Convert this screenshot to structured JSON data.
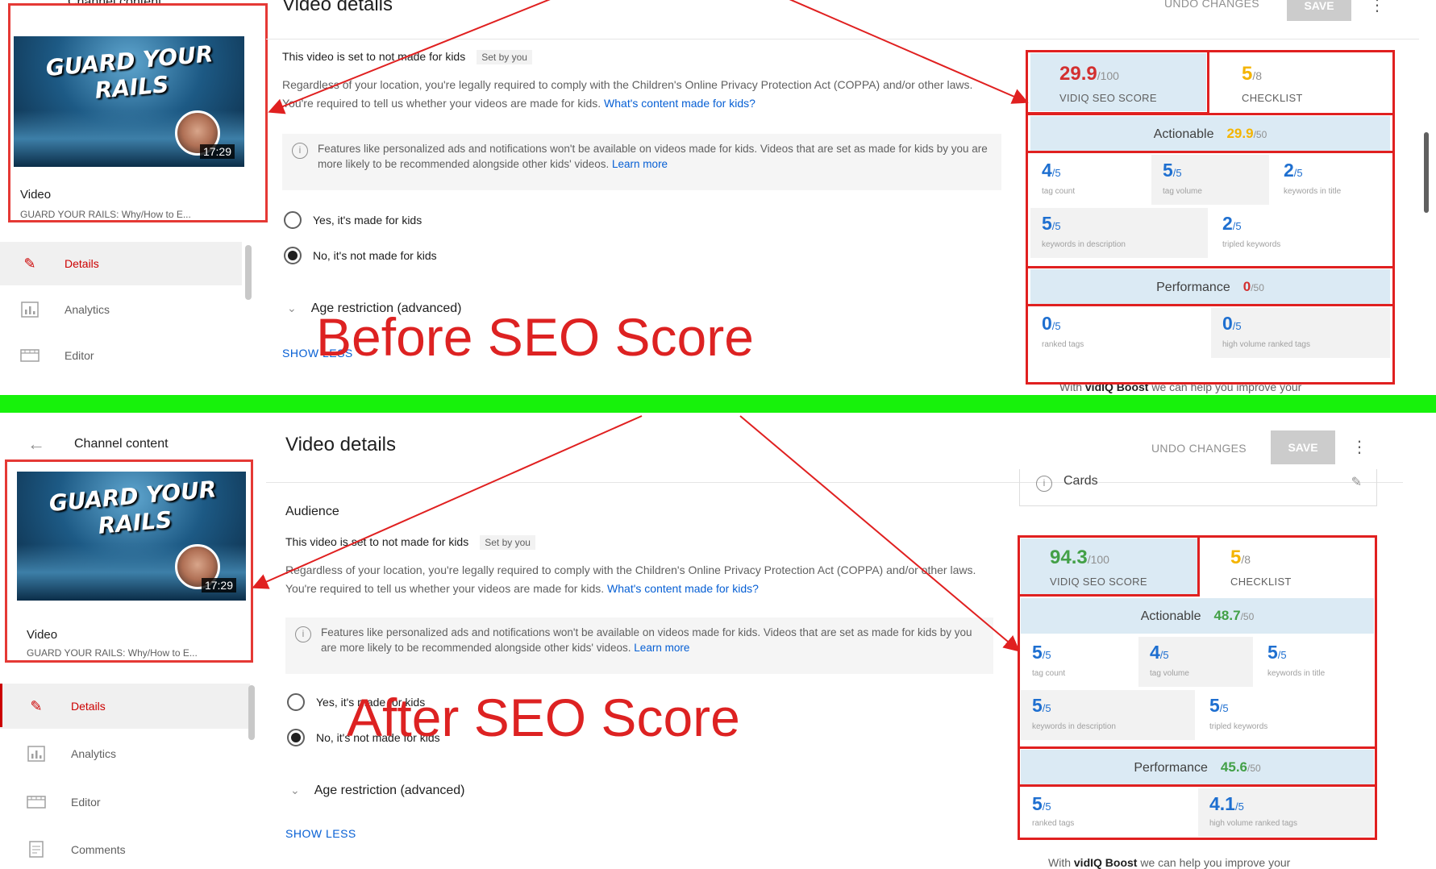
{
  "before": {
    "channel_content": "Channel content",
    "page_title": "Video details",
    "thumbnail_text": "GUARD YOUR RAILS",
    "duration": "17:29",
    "video_label": "Video",
    "video_subtitle": "GUARD YOUR RAILS: Why/How to E...",
    "nav": [
      {
        "label": "Details",
        "icon": "pencil-icon"
      },
      {
        "label": "Analytics",
        "icon": "bar-chart-icon"
      },
      {
        "label": "Editor",
        "icon": "film-icon"
      }
    ],
    "kids_line": "This video is set to not made for kids",
    "set_by_you": "Set by you",
    "body_text": "Regardless of your location, you're legally required to comply with the Children's Online Privacy Protection Act (COPPA) and/or other laws. You're required to tell us whether your videos are made for kids.",
    "body_link": "What's content made for kids?",
    "info_text": "Features like personalized ads and notifications won't be available on videos made for kids. Videos that are set as made for kids by you are more likely to be recommended alongside other kids' videos.",
    "info_link": "Learn more",
    "radio_yes": "Yes, it's made for kids",
    "radio_no": "No, it's not made for kids",
    "age_restriction": "Age restriction (advanced)",
    "show_link": "SHOW LESS",
    "undo": "UNDO CHANGES",
    "save": "SAVE",
    "overlay": "Before SEO Score",
    "seo": {
      "score": "29.9",
      "score_den": "/100",
      "score_label": "VIDIQ SEO SCORE",
      "checklist": "5",
      "checklist_den": "/8",
      "checklist_label": "CHECKLIST",
      "actionable_label": "Actionable",
      "actionable_score": "29.9",
      "actionable_den": "/50",
      "performance_label": "Performance",
      "performance_score": "0",
      "performance_den": "/50",
      "actionable_metrics": [
        {
          "value": "4",
          "den": "/5",
          "label": "tag count"
        },
        {
          "value": "5",
          "den": "/5",
          "label": "tag volume"
        },
        {
          "value": "2",
          "den": "/5",
          "label": "keywords in title"
        },
        {
          "value": "5",
          "den": "/5",
          "label": "keywords in description"
        },
        {
          "value": "2",
          "den": "/5",
          "label": "tripled keywords"
        }
      ],
      "performance_metrics": [
        {
          "value": "0",
          "den": "/5",
          "label": "ranked tags"
        },
        {
          "value": "0",
          "den": "/5",
          "label": "high volume ranked tags"
        }
      ],
      "boost_prefix": "With ",
      "boost_brand": "vidIQ Boost",
      "boost_suffix": " we can help you improve your"
    }
  },
  "after": {
    "channel_content": "Channel content",
    "page_title": "Video details",
    "audience": "Audience",
    "thumbnail_text": "GUARD YOUR RAILS",
    "duration": "17:29",
    "video_label": "Video",
    "video_subtitle": "GUARD YOUR RAILS: Why/How to E...",
    "nav": [
      {
        "label": "Details",
        "icon": "pencil-icon"
      },
      {
        "label": "Analytics",
        "icon": "bar-chart-icon"
      },
      {
        "label": "Editor",
        "icon": "film-icon"
      },
      {
        "label": "Comments",
        "icon": "comment-icon"
      }
    ],
    "kids_line": "This video is set to not made for kids",
    "set_by_you": "Set by you",
    "body_text": "Regardless of your location, you're legally required to comply with the Children's Online Privacy Protection Act (COPPA) and/or other laws. You're required to tell us whether your videos are made for kids.",
    "body_link": "What's content made for kids?",
    "info_text": "Features like personalized ads and notifications won't be available on videos made for kids. Videos that are set as made for kids by you are more likely to be recommended alongside other kids' videos.",
    "info_link": "Learn more",
    "radio_yes": "Yes, it's made for kids",
    "radio_no": "No, it's not made for kids",
    "age_restriction": "Age restriction (advanced)",
    "show_link": "SHOW LESS",
    "undo": "UNDO CHANGES",
    "save": "SAVE",
    "cards": "Cards",
    "overlay": "After SEO Score",
    "seo": {
      "score": "94.3",
      "score_den": "/100",
      "score_label": "VIDIQ SEO SCORE",
      "checklist": "5",
      "checklist_den": "/8",
      "checklist_label": "CHECKLIST",
      "actionable_label": "Actionable",
      "actionable_score": "48.7",
      "actionable_den": "/50",
      "performance_label": "Performance",
      "performance_score": "45.6",
      "performance_den": "/50",
      "actionable_metrics": [
        {
          "value": "5",
          "den": "/5",
          "label": "tag count"
        },
        {
          "value": "4",
          "den": "/5",
          "label": "tag volume"
        },
        {
          "value": "5",
          "den": "/5",
          "label": "keywords in title"
        },
        {
          "value": "5",
          "den": "/5",
          "label": "keywords in description"
        },
        {
          "value": "5",
          "den": "/5",
          "label": "tripled keywords"
        }
      ],
      "performance_metrics": [
        {
          "value": "5",
          "den": "/5",
          "label": "ranked tags"
        },
        {
          "value": "4.1",
          "den": "/5",
          "label": "high volume ranked tags"
        }
      ],
      "boost_prefix": "With ",
      "boost_brand": "vidIQ Boost",
      "boost_suffix": " we can help you improve your"
    }
  },
  "colors": {
    "annotation_red": "#e02020",
    "divider_green": "#17f20b",
    "score_low_red": "#d32f2f",
    "score_high_green": "#43a047",
    "checklist_yellow": "#f4b400",
    "metric_blue": "#1e6fd0",
    "link_blue": "#065fd4",
    "panel_blue": "#dbeaf4"
  }
}
